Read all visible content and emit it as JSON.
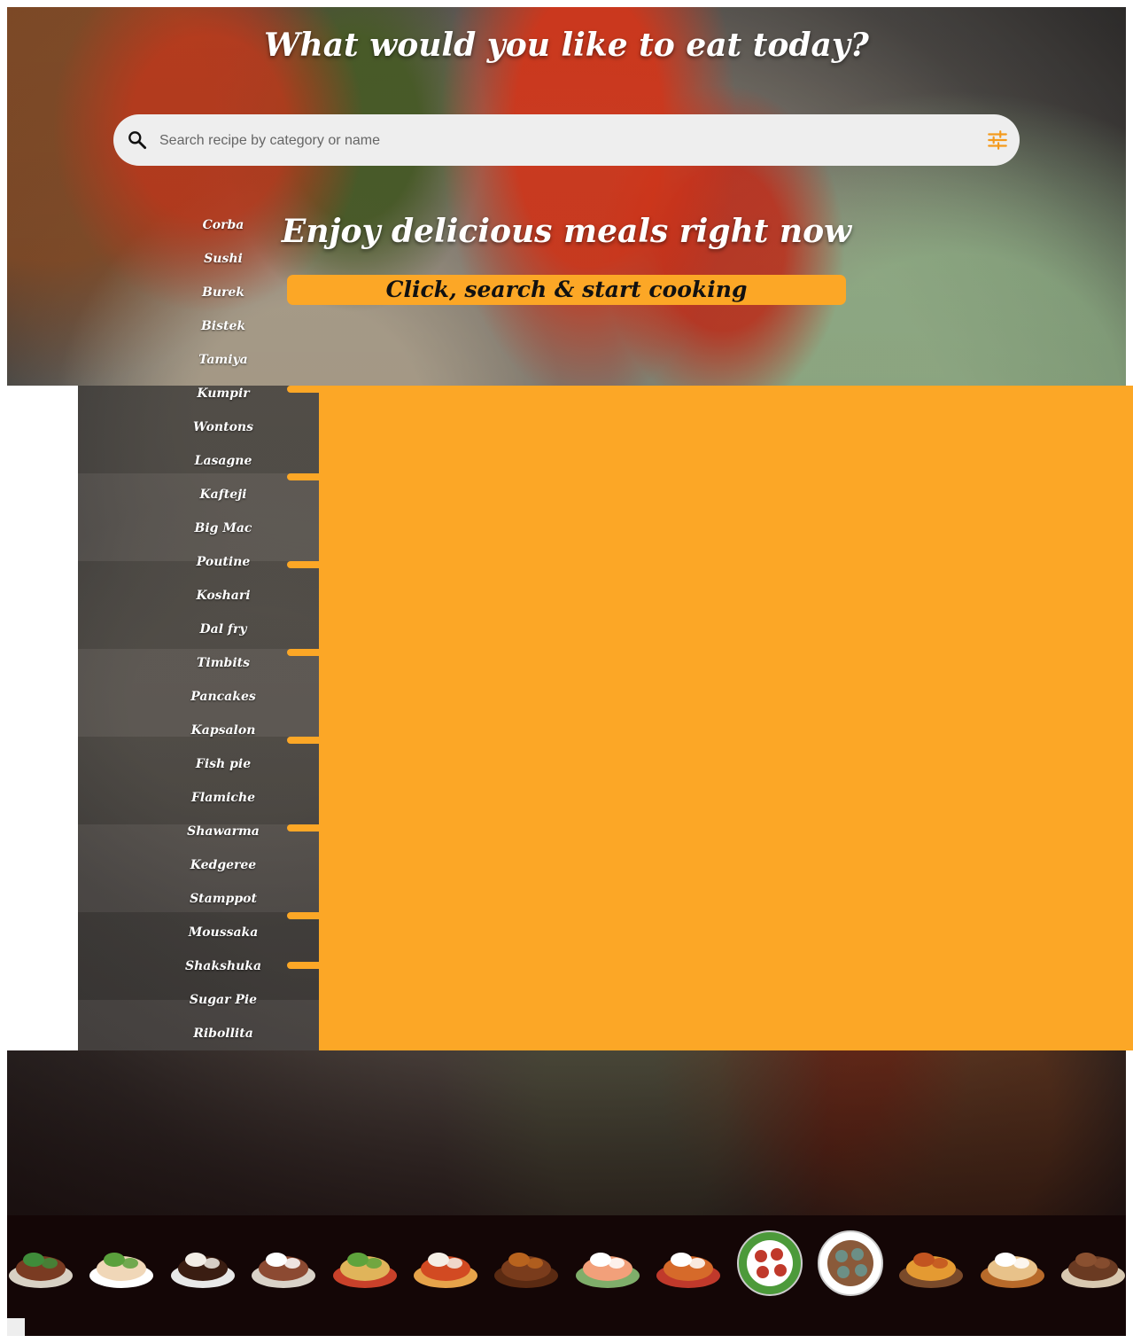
{
  "header": {
    "title": "What would you like to eat today?"
  },
  "search": {
    "placeholder": "Search recipe by category or name",
    "value": ""
  },
  "hero": {
    "subtitle": "Enjoy delicious meals right now",
    "cta_label": "Click, search & start cooking"
  },
  "sidebar": {
    "items": [
      "Corba",
      "Sushi",
      "Burek",
      "Bistek",
      "Tamiya",
      "Kumpir",
      "Wontons",
      "Lasagne",
      "Kafteji",
      "Big Mac",
      "Poutine",
      "Koshari",
      "Dal fry",
      "Timbits",
      "Pancakes",
      "Kapsalon",
      "Fish pie",
      "Flamiche",
      "Shawarma",
      "Kedgeree",
      "Stamppot",
      "Moussaka",
      "Shakshuka",
      "Sugar Pie",
      "Ribollita"
    ]
  },
  "colors": {
    "accent": "#fca726",
    "search_bg": "#eeeeee",
    "strip_bg": "#140606"
  },
  "food_strip": {
    "icons": [
      "steak-salad-icon",
      "raw-chicken-icon",
      "chocolate-dessert-icon",
      "lamb-chops-icon",
      "tacos-icon",
      "pasta-icon",
      "grilled-steak-icon",
      "salmon-icon",
      "side-dishes-icon",
      "caprese-icon",
      "meat-platter-icon",
      "party-platter-icon",
      "pancakes-icon",
      "kebab-icon"
    ]
  }
}
